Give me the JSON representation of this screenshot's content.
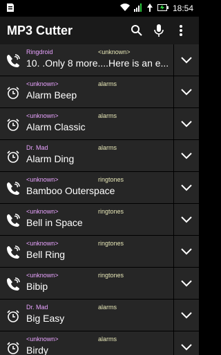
{
  "status": {
    "time": "18:54"
  },
  "toolbar": {
    "title": "MP3 Cutter"
  },
  "items": [
    {
      "type": "ringtone",
      "artist": "Ringdroid",
      "album": "<unknown>",
      "name": "10. .Only 8 more....Here is an e..."
    },
    {
      "type": "alarm",
      "artist": "<unknown>",
      "album": "alarms",
      "name": "Alarm Beep"
    },
    {
      "type": "alarm",
      "artist": "<unknown>",
      "album": "alarms",
      "name": "Alarm Classic"
    },
    {
      "type": "alarm",
      "artist": "Dr. Mad",
      "album": "alarms",
      "name": "Alarm Ding"
    },
    {
      "type": "ringtone",
      "artist": "<unknown>",
      "album": "ringtones",
      "name": "Bamboo Outerspace"
    },
    {
      "type": "ringtone",
      "artist": "<unknown>",
      "album": "ringtones",
      "name": "Bell in Space"
    },
    {
      "type": "ringtone",
      "artist": "<unknown>",
      "album": "ringtones",
      "name": "Bell Ring"
    },
    {
      "type": "ringtone",
      "artist": "<unknown>",
      "album": "ringtones",
      "name": "Bibip"
    },
    {
      "type": "alarm",
      "artist": "Dr. Mad",
      "album": "alarms",
      "name": "Big Easy"
    },
    {
      "type": "alarm",
      "artist": "<unknown>",
      "album": "alarms",
      "name": "Birdy"
    }
  ]
}
